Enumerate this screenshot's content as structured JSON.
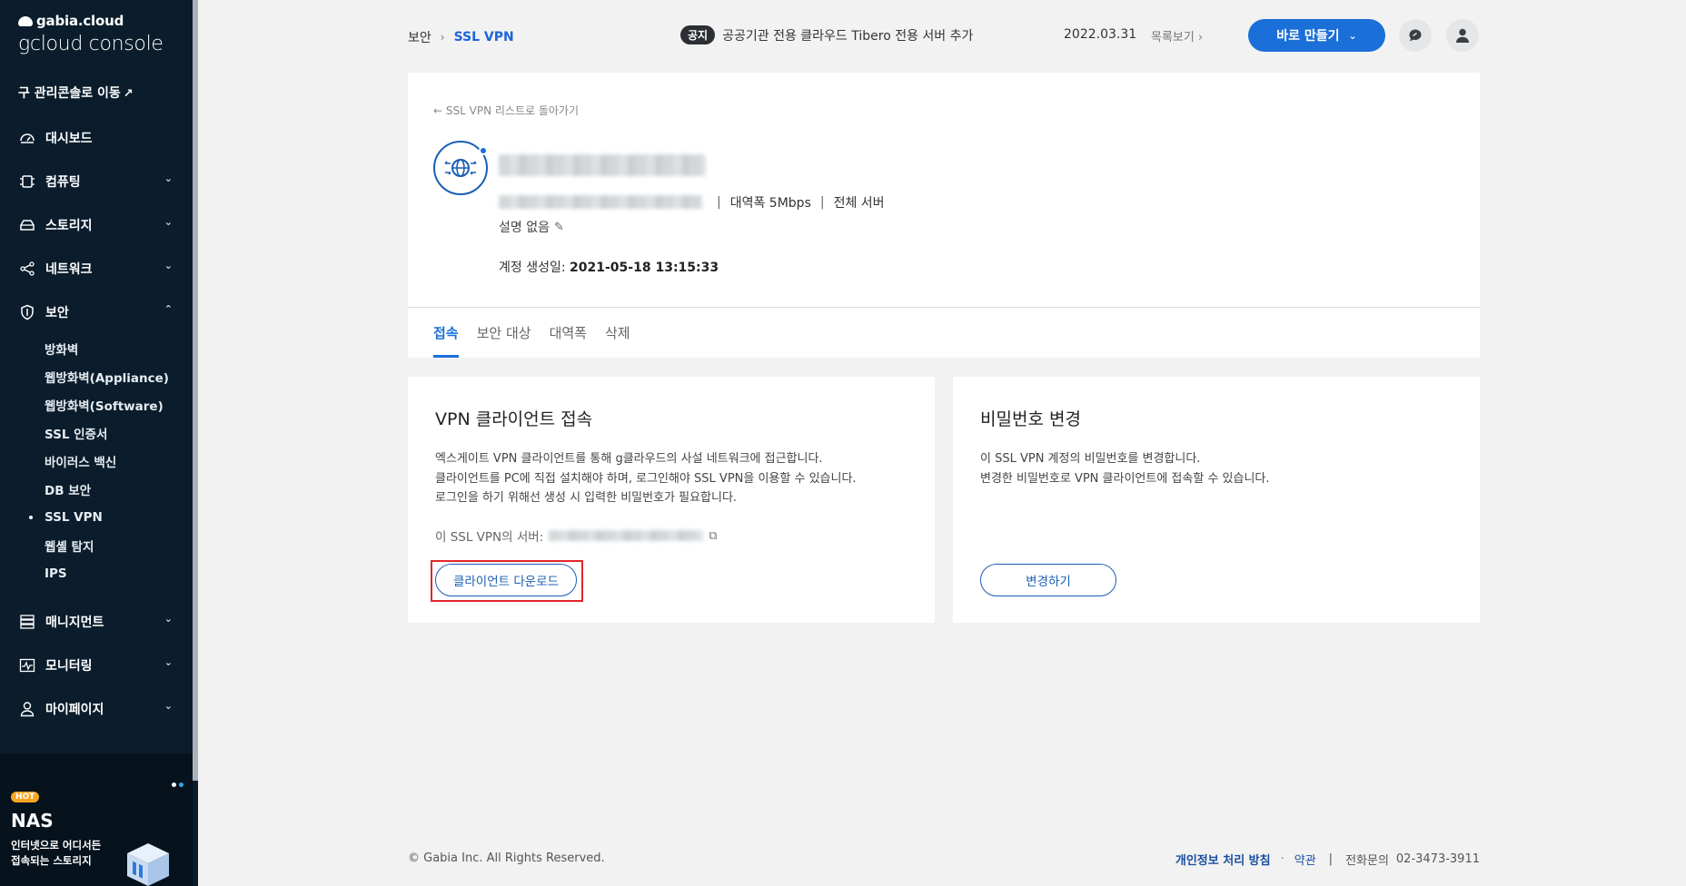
{
  "sidebar": {
    "brand_small": "gabia.cloud",
    "brand_big": "gcloud console",
    "legacy_link": "구 관리콘솔로 이동",
    "items": [
      {
        "label": "대시보드",
        "icon": "dashboard-icon",
        "expandable": false
      },
      {
        "label": "컴퓨팅",
        "icon": "chip-icon",
        "expandable": true
      },
      {
        "label": "스토리지",
        "icon": "storage-icon",
        "expandable": true
      },
      {
        "label": "네트워크",
        "icon": "network-icon",
        "expandable": true
      },
      {
        "label": "보안",
        "icon": "shield-icon",
        "expandable": true,
        "expanded": true
      }
    ],
    "security_sub": [
      "방화벽",
      "웹방화벽(Appliance)",
      "웹방화벽(Software)",
      "SSL 인증서",
      "바이러스 백신",
      "DB 보안",
      "SSL VPN",
      "웹셸 탐지",
      "IPS"
    ],
    "security_active": "SSL VPN",
    "items_bottom": [
      {
        "label": "매니지먼트",
        "icon": "management-icon"
      },
      {
        "label": "모니터링",
        "icon": "monitoring-icon"
      },
      {
        "label": "마이페이지",
        "icon": "user-icon"
      }
    ],
    "promo": {
      "badge": "HOT",
      "title": "NAS",
      "desc": "인터넷으로 어디서든\n접속되는 스토리지"
    }
  },
  "header": {
    "breadcrumb_parent": "보안",
    "breadcrumb_current": "SSL VPN",
    "notice_badge": "공지",
    "notice_text": "공공기관 전용 클라우드 Tibero 전용 서버 추가",
    "notice_date": "2022.03.31",
    "notice_more": "목록보기",
    "create_button": "바로 만들기"
  },
  "detail": {
    "back_link": "SSL VPN 리스트로 돌아가기",
    "bandwidth": "대역폭 5Mbps",
    "scope": "전체 서버",
    "description": "설명 없음",
    "created_label": "계정 생성일:",
    "created_value": "2021-05-18 13:15:33",
    "tabs": [
      "접속",
      "보안 대상",
      "대역폭",
      "삭제"
    ],
    "active_tab": "접속"
  },
  "client_card": {
    "title": "VPN 클라이언트 접속",
    "lines": [
      "엑스게이트 VPN 클라이언트를 통해 g클라우드의 사설 네트워크에 접근합니다.",
      "클라이언트를 PC에 직접 설치해야 하며, 로그인해야 SSL VPN을 이용할 수 있습니다.",
      "로그인을 하기 위해선 생성 시 입력한 비밀번호가 필요합니다."
    ],
    "server_label": "이 SSL VPN의 서버:",
    "download_button": "클라이언트 다운로드"
  },
  "password_card": {
    "title": "비밀번호 변경",
    "lines": [
      "이 SSL VPN 계정의 비밀번호를 변경합니다.",
      "변경한 비밀번호로 VPN 클라이언트에 접속할 수 있습니다."
    ],
    "change_button": "변경하기"
  },
  "footer": {
    "copyright": "© Gabia Inc. All Rights Reserved.",
    "privacy": "개인정보 처리 방침",
    "terms": "약관",
    "phone_label": "전화문의",
    "phone": "02-3473-3911"
  },
  "colors": {
    "sidebar_bg": "#0b1d2c",
    "accent": "#1a6fd8",
    "highlight": "#e3262b"
  }
}
